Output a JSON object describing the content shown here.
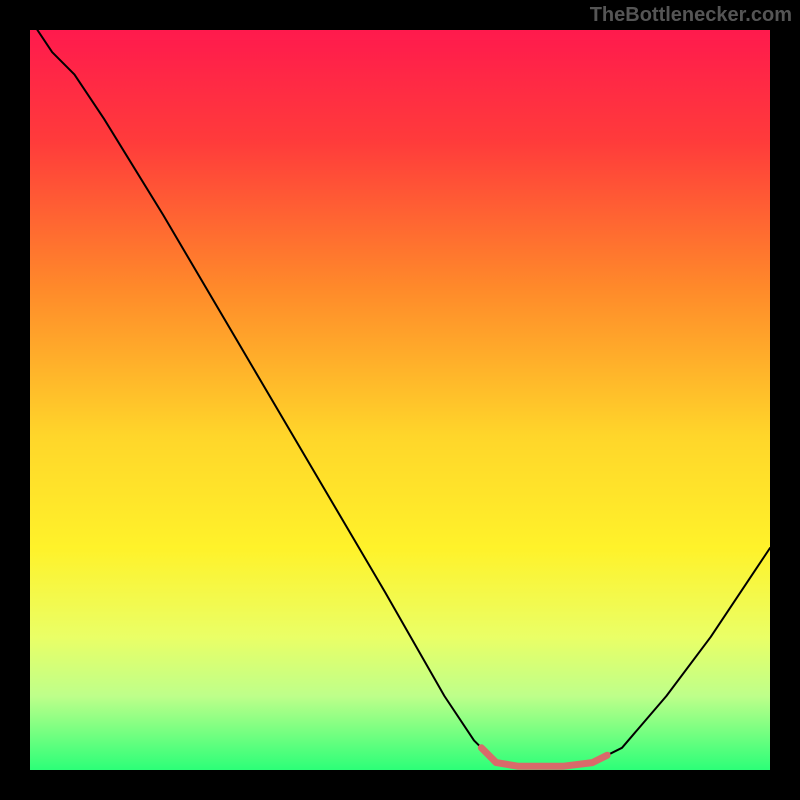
{
  "watermark": "TheBottlenecker.com",
  "chart_data": {
    "type": "line",
    "title": "",
    "xlabel": "",
    "ylabel": "",
    "xlim": [
      0,
      100
    ],
    "ylim": [
      0,
      100
    ],
    "background_gradient": {
      "stops": [
        {
          "offset": 0,
          "color": "#ff1a4d"
        },
        {
          "offset": 15,
          "color": "#ff3b3b"
        },
        {
          "offset": 35,
          "color": "#ff8a2a"
        },
        {
          "offset": 55,
          "color": "#ffd62a"
        },
        {
          "offset": 70,
          "color": "#fff22a"
        },
        {
          "offset": 82,
          "color": "#eaff66"
        },
        {
          "offset": 90,
          "color": "#beff8a"
        },
        {
          "offset": 100,
          "color": "#2cff78"
        }
      ]
    },
    "series": [
      {
        "name": "bottleneck-curve",
        "color": "#000000",
        "width": 2,
        "points": [
          {
            "x": 1,
            "y": 100
          },
          {
            "x": 3,
            "y": 97
          },
          {
            "x": 6,
            "y": 94
          },
          {
            "x": 10,
            "y": 88
          },
          {
            "x": 18,
            "y": 75
          },
          {
            "x": 28,
            "y": 58
          },
          {
            "x": 38,
            "y": 41
          },
          {
            "x": 48,
            "y": 24
          },
          {
            "x": 56,
            "y": 10
          },
          {
            "x": 60,
            "y": 4
          },
          {
            "x": 63,
            "y": 1
          },
          {
            "x": 66,
            "y": 0.5
          },
          {
            "x": 72,
            "y": 0.5
          },
          {
            "x": 76,
            "y": 1
          },
          {
            "x": 80,
            "y": 3
          },
          {
            "x": 86,
            "y": 10
          },
          {
            "x": 92,
            "y": 18
          },
          {
            "x": 98,
            "y": 27
          },
          {
            "x": 100,
            "y": 30
          }
        ]
      },
      {
        "name": "highlight-segment",
        "color": "#d96a6a",
        "width": 7,
        "points": [
          {
            "x": 61,
            "y": 3
          },
          {
            "x": 63,
            "y": 1
          },
          {
            "x": 66,
            "y": 0.5
          },
          {
            "x": 72,
            "y": 0.5
          },
          {
            "x": 76,
            "y": 1
          },
          {
            "x": 78,
            "y": 2
          }
        ]
      }
    ]
  }
}
